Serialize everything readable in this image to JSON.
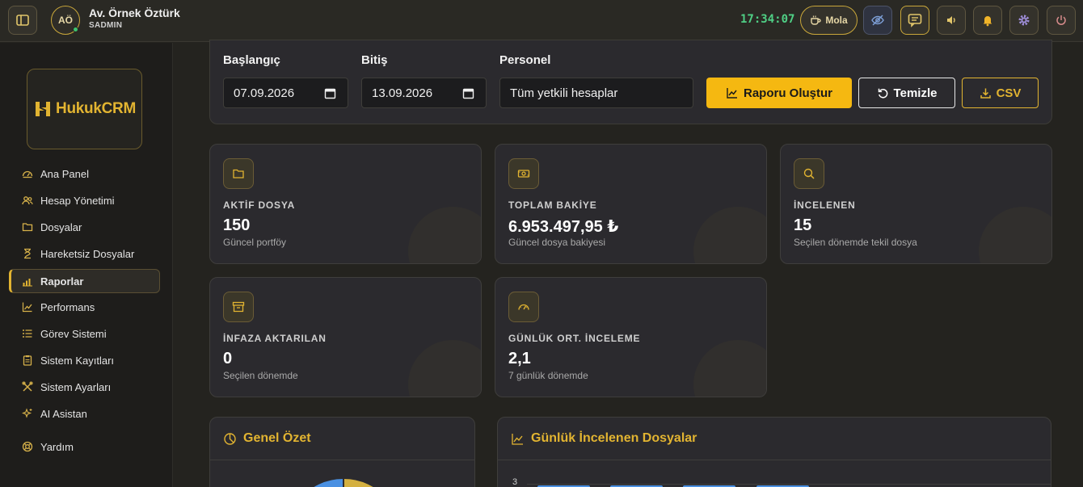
{
  "user": {
    "initials": "AÖ",
    "name": "Av. Örnek Öztürk",
    "role": "SADMIN"
  },
  "clock": "17:34:07",
  "topbar": {
    "break_label": "Mola"
  },
  "brand": {
    "logo_text": "HukukCRM"
  },
  "sidebar": {
    "items": [
      {
        "label": "Ana Panel",
        "icon": "dashboard-icon"
      },
      {
        "label": "Hesap Yönetimi",
        "icon": "users-icon"
      },
      {
        "label": "Dosyalar",
        "icon": "folder-icon"
      },
      {
        "label": "Hareketsiz Dosyalar",
        "icon": "hourglass-icon"
      },
      {
        "label": "Raporlar",
        "icon": "bar-chart-icon",
        "active": true
      },
      {
        "label": "Performans",
        "icon": "trend-icon"
      },
      {
        "label": "Görev Sistemi",
        "icon": "list-icon"
      },
      {
        "label": "Sistem Kayıtları",
        "icon": "clipboard-icon"
      },
      {
        "label": "Sistem Ayarları",
        "icon": "tools-icon"
      },
      {
        "label": "AI Asistan",
        "icon": "sparkle-icon"
      },
      {
        "label": "Yardım",
        "icon": "lifebuoy-icon"
      }
    ]
  },
  "filters": {
    "start_label": "Başlangıç",
    "start_value": "07.09.2026",
    "end_label": "Bitiş",
    "end_value": "13.09.2026",
    "staff_label": "Personel",
    "staff_value": "Tüm yetkili hesaplar",
    "generate_label": "Raporu Oluştur",
    "clear_label": "Temizle",
    "csv_label": "CSV"
  },
  "stats": [
    {
      "label": "AKTİF DOSYA",
      "value": "150",
      "sub": "Güncel portföy",
      "icon": "folder-icon"
    },
    {
      "label": "TOPLAM BAKİYE",
      "value": "6.953.497,95 ₺",
      "sub": "Güncel dosya bakiyesi",
      "icon": "money-icon"
    },
    {
      "label": "İNCELENEN",
      "value": "15",
      "sub": "Seçilen dönemde tekil dosya",
      "icon": "search-icon"
    },
    {
      "label": "İNFAZA AKTARILAN",
      "value": "0",
      "sub": "Seçilen dönemde",
      "icon": "archive-icon"
    },
    {
      "label": "GÜNLÜK ORT. İNCELEME",
      "value": "2,1",
      "sub": "7 günlük dönemde",
      "icon": "gauge-icon"
    }
  ],
  "panels": {
    "summary_title": "Genel Özet",
    "daily_title": "Günlük İncelenen Dosyalar",
    "daily_y_top_tick": "3"
  },
  "colors": {
    "accent": "#e2b431",
    "online": "#3ec46d",
    "clock": "#4fcf85",
    "bar": "#4a90e2"
  }
}
